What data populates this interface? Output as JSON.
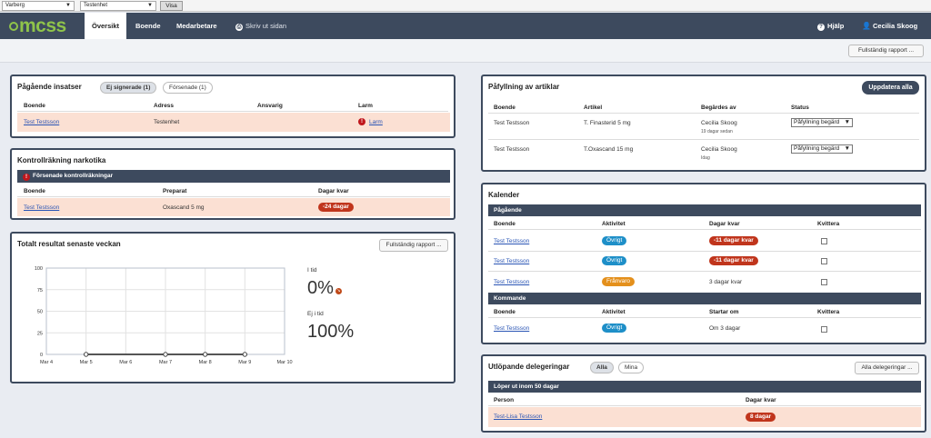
{
  "topbar": {
    "unit_select": "Varberg",
    "dept_select": "Testenhet",
    "show_button": "Visa"
  },
  "nav": {
    "logo": "mcss",
    "items": [
      "Översikt",
      "Boende",
      "Medarbetare"
    ],
    "print": "Skriv ut sidan",
    "help": "Hjälp",
    "user": "Cecilia Skoog"
  },
  "report_button": "Fullständig rapport ...",
  "insatser": {
    "title": "Pågående insatser",
    "tab_unsigned": "Ej signerade (1)",
    "tab_late": "Försenade (1)",
    "headers": [
      "Boende",
      "Adress",
      "Ansvarig",
      "Larm"
    ],
    "row": {
      "boende": "Test Testsson",
      "adress": "Testenhet",
      "ansvarig": "",
      "larm": "Larm"
    }
  },
  "narkotika": {
    "title": "Kontrollräkning narkotika",
    "bar": "Försenade kontrollräkningar",
    "headers": [
      "Boende",
      "Preparat",
      "Dagar kvar"
    ],
    "row": {
      "boende": "Test Testsson",
      "preparat": "Oxascand 5 mg",
      "dagar": "-24 dagar"
    }
  },
  "resultat": {
    "title": "Totalt resultat senaste veckan",
    "report_button": "Fullständig rapport ...",
    "in_time_label": "I tid",
    "in_time_value": "0%",
    "late_label": "Ej i tid",
    "late_value": "100%"
  },
  "chart_data": {
    "type": "line",
    "x": [
      "Mar 4",
      "Mar 5",
      "Mar 6",
      "Mar 7",
      "Mar 8",
      "Mar 9",
      "Mar 10"
    ],
    "series": [
      {
        "values": [
          null,
          0,
          null,
          0,
          0,
          0,
          null
        ]
      }
    ],
    "yticks": [
      0,
      25,
      50,
      75,
      100
    ],
    "ylim": [
      0,
      100
    ],
    "grid": true
  },
  "artiklar": {
    "title": "Påfyllning av artiklar",
    "update_button": "Uppdatera alla",
    "headers": [
      "Boende",
      "Artikel",
      "Begärdes av",
      "Status"
    ],
    "rows": [
      {
        "boende": "Test Testsson",
        "artikel": "T. Finasterid 5 mg",
        "by": "Cecilia Skoog",
        "when": "19 dagar sedan",
        "status": "Påfyllning begärd"
      },
      {
        "boende": "Test Testsson",
        "artikel": "T.Oxascand 15 mg",
        "by": "Cecilia Skoog",
        "when": "Idag",
        "status": "Påfyllning begärd"
      }
    ]
  },
  "kalender": {
    "title": "Kalender",
    "ongoing_bar": "Pågående",
    "headers": [
      "Boende",
      "Aktivitet",
      "Dagar kvar",
      "Kvittera"
    ],
    "ongoing": [
      {
        "boende": "Test Testsson",
        "aktivitet": "Övrigt",
        "dagar": "-11 dagar kvar"
      },
      {
        "boende": "Test Testsson",
        "aktivitet": "Övrigt",
        "dagar": "-11 dagar kvar"
      },
      {
        "boende": "Test Testsson",
        "aktivitet": "Frånvaro",
        "dagar": "3 dagar kvar"
      }
    ],
    "upcoming_bar": "Kommande",
    "upcoming_headers": [
      "Boende",
      "Aktivitet",
      "Startar om",
      "Kvittera"
    ],
    "upcoming": [
      {
        "boende": "Test Testsson",
        "aktivitet": "Övrigt",
        "start": "Om 3 dagar"
      }
    ]
  },
  "delegeringar": {
    "title": "Utlöpande delegeringar",
    "tab_all": "Alla",
    "tab_mine": "Mina",
    "all_button": "Alla delegeringar ...",
    "bar": "Löper ut inom 50 dagar",
    "headers": [
      "Person",
      "Dagar kvar"
    ],
    "row": {
      "person": "Test-Lisa Testsson",
      "dagar": "8 dagar"
    }
  },
  "colors": {
    "nav": "#3d4a5e",
    "accent_green": "#8fc34a",
    "danger": "#c0351c",
    "info": "#1e8fc8",
    "warning": "#e4901c",
    "row_highlight": "#fbe0d3"
  }
}
